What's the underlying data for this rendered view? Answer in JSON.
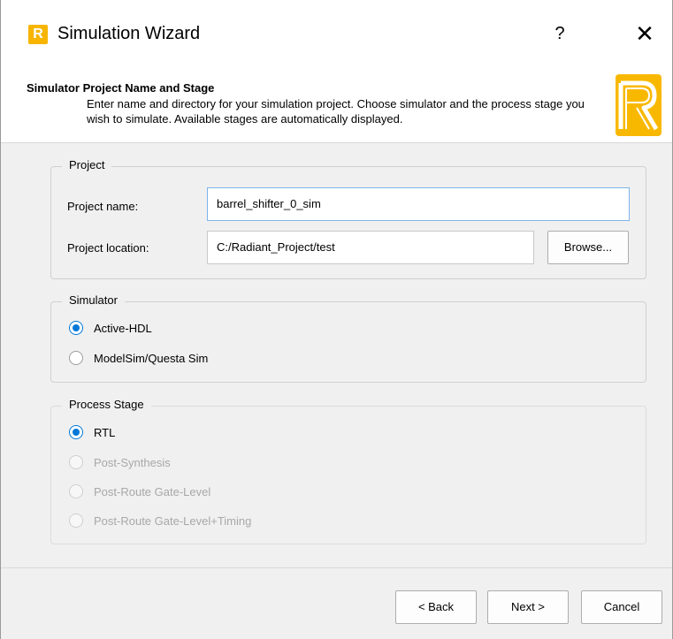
{
  "window": {
    "title": "Simulation Wizard",
    "help_glyph": "?",
    "close_glyph": "✕",
    "app_icon": "radiant-logo-icon",
    "app_icon_letter": "R"
  },
  "header": {
    "title": "Simulator Project Name and Stage",
    "description": "Enter name and directory for your simulation project. Choose simulator and the process stage you wish to simulate. Available stages are automatically displayed."
  },
  "project": {
    "legend": "Project",
    "name_label": "Project name:",
    "name_value": "barrel_shifter_0_sim",
    "location_label": "Project location:",
    "location_value": "C:/Radiant_Project/test",
    "browse_label": "Browse..."
  },
  "simulator": {
    "legend": "Simulator",
    "options": [
      {
        "label": "Active-HDL",
        "checked": true,
        "enabled": true
      },
      {
        "label": "ModelSim/Questa Sim",
        "checked": false,
        "enabled": true
      }
    ]
  },
  "process_stage": {
    "legend": "Process Stage",
    "options": [
      {
        "label": "RTL",
        "checked": true,
        "enabled": true
      },
      {
        "label": "Post-Synthesis",
        "checked": false,
        "enabled": false
      },
      {
        "label": "Post-Route Gate-Level",
        "checked": false,
        "enabled": false
      },
      {
        "label": "Post-Route Gate-Level+Timing",
        "checked": false,
        "enabled": false
      }
    ]
  },
  "footer": {
    "back_label": "< Back",
    "next_label": "Next >",
    "cancel_label": "Cancel"
  },
  "colors": {
    "accent": "#0078d7",
    "brand": "#f7b500"
  }
}
